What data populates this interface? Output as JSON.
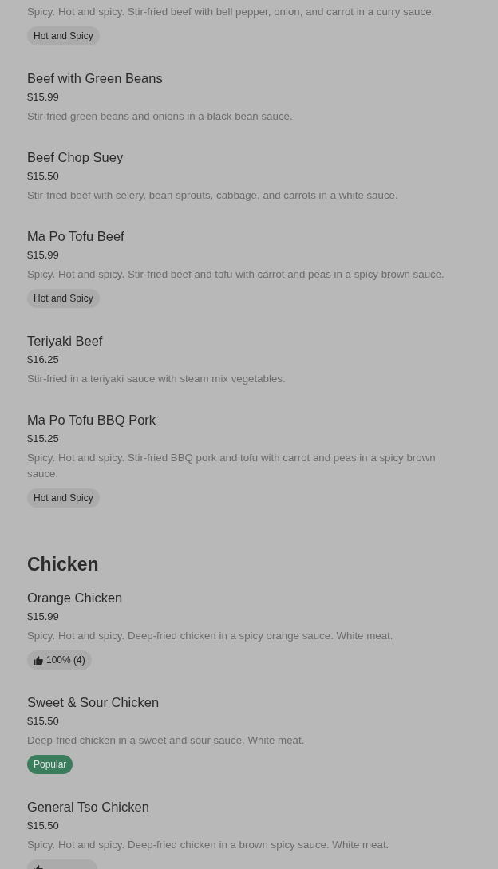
{
  "sections": [
    {
      "items": [
        {
          "description": "Spicy. Hot and spicy. Stir-fried beef with bell pepper, onion, and carrot in a curry sauce.",
          "badges": [
            {
              "kind": "tag",
              "label": "Hot and Spicy"
            }
          ]
        },
        {
          "name": "Beef with Green Beans",
          "price": "$15.99",
          "description": "Stir-fried green beans and onions in a black bean sauce."
        },
        {
          "name": "Beef Chop Suey",
          "price": "$15.50",
          "description": "Stir-fried beef with celery, bean sprouts, cabbage, and carrots in a white sauce."
        },
        {
          "name": "Ma Po Tofu Beef",
          "price": "$15.99",
          "description": "Spicy. Hot and spicy. Stir-fried beef and tofu with carrot and peas in a spicy brown sauce.",
          "badges": [
            {
              "kind": "tag",
              "label": "Hot and Spicy"
            }
          ]
        },
        {
          "name": "Teriyaki Beef",
          "price": "$16.25",
          "description": "Stir-fried in a teriyaki sauce with steam mix vegetables."
        },
        {
          "name": "Ma Po Tofu BBQ Pork",
          "price": "$15.25",
          "description": "Spicy. Hot and spicy. Stir-fried BBQ pork and tofu with carrot and peas in a spicy brown sauce.",
          "badges": [
            {
              "kind": "tag",
              "label": "Hot and Spicy"
            }
          ]
        }
      ]
    },
    {
      "heading": "Chicken",
      "items": [
        {
          "name": "Orange Chicken",
          "price": "$15.99",
          "description": "Spicy. Hot and spicy. Deep-fried chicken in a spicy orange sauce. White meat.",
          "badges": [
            {
              "kind": "rating",
              "label": "100% (4)"
            }
          ]
        },
        {
          "name": "Sweet & Sour Chicken",
          "price": "$15.50",
          "description": "Deep-fried chicken in a sweet and sour sauce. White meat.",
          "badges": [
            {
              "kind": "popular",
              "label": "Popular"
            }
          ]
        },
        {
          "name": "General Tso Chicken",
          "price": "$15.50",
          "description": "Spicy. Hot and spicy. Deep-fried chicken in a brown spicy sauce. White meat.",
          "badges": [
            {
              "kind": "rating"
            }
          ]
        }
      ]
    }
  ]
}
